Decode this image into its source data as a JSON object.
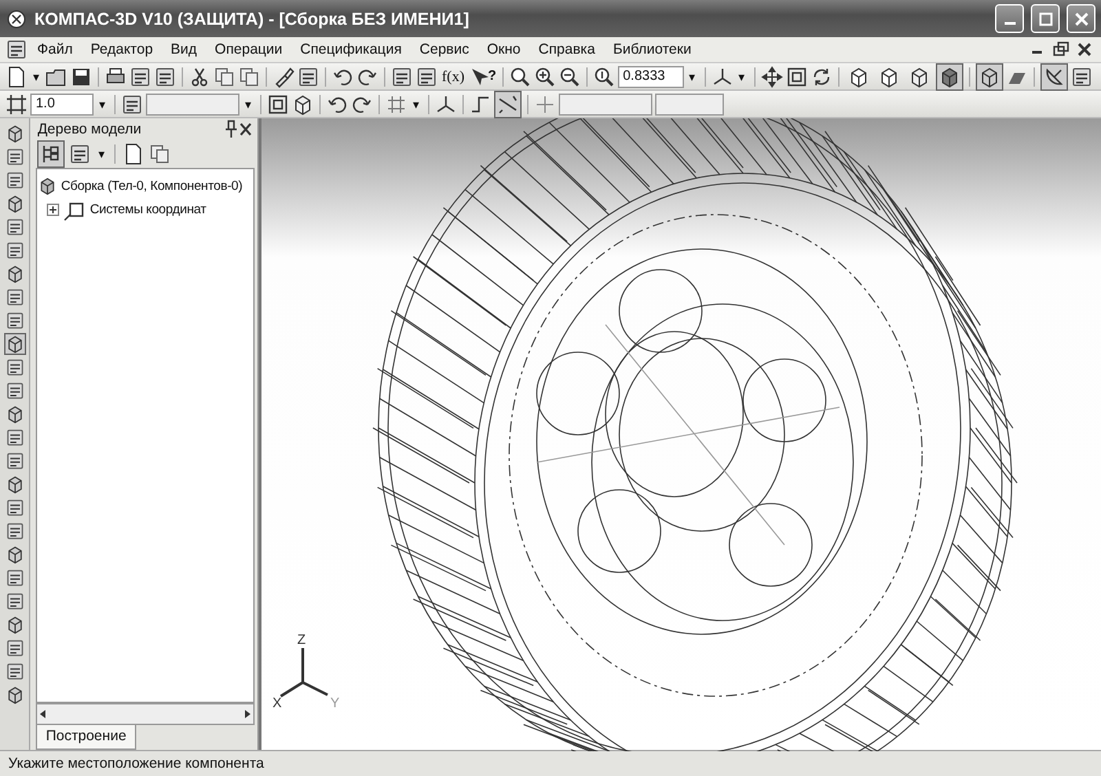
{
  "window": {
    "title": "КОМПАС-3D V10 (ЗАЩИТА) - [Сборка БЕЗ ИМЕНИ1]"
  },
  "menu": [
    "Файл",
    "Редактор",
    "Вид",
    "Операции",
    "Спецификация",
    "Сервис",
    "Окно",
    "Справка",
    "Библиотеки"
  ],
  "toolbar": {
    "function_label": "f(x)",
    "help_label": "?",
    "dropdown_arrows": [
      "▾",
      "▾",
      "▾"
    ],
    "zoom_value": "0.8333",
    "display_modes": [
      {
        "selected": false
      },
      {
        "selected": false
      },
      {
        "selected": false
      },
      {
        "selected": true
      }
    ],
    "perspective": {
      "on": true
    },
    "toggle_model": {
      "on": true
    }
  },
  "toolbar_2": {
    "dropdown_arrows": [
      "▾",
      "▾",
      "▾"
    ],
    "line_style": "1.0",
    "snap_toggle": {
      "on": true
    }
  },
  "tool_strip": [
    {
      "selected": false
    },
    {
      "selected": false
    },
    {
      "selected": false
    },
    {
      "selected": false
    },
    {
      "selected": false
    },
    {
      "selected": false
    },
    {
      "selected": false
    },
    {
      "selected": false
    },
    {
      "selected": false
    },
    {
      "selected": true
    },
    {
      "selected": false
    },
    {
      "selected": false
    },
    {
      "selected": false
    },
    {
      "selected": false
    },
    {
      "selected": false
    },
    {
      "selected": false
    },
    {
      "selected": false
    },
    {
      "selected": false
    },
    {
      "selected": false
    },
    {
      "selected": false
    },
    {
      "selected": false
    },
    {
      "selected": false
    },
    {
      "selected": false
    },
    {
      "selected": false
    },
    {
      "selected": false
    }
  ],
  "model_tree": {
    "title": "Дерево модели",
    "items": [
      {
        "label": "Сборка (Тел-0, Компонентов-0)",
        "children": [
          {
            "label": "Системы координат",
            "expanded": false
          }
        ]
      }
    ],
    "tab": "Построение",
    "dropdown_arrow": "▾"
  },
  "viewport": {
    "axes": [
      "X",
      "Y",
      "Z"
    ]
  },
  "status_bar": "Укажите местоположение компонента"
}
